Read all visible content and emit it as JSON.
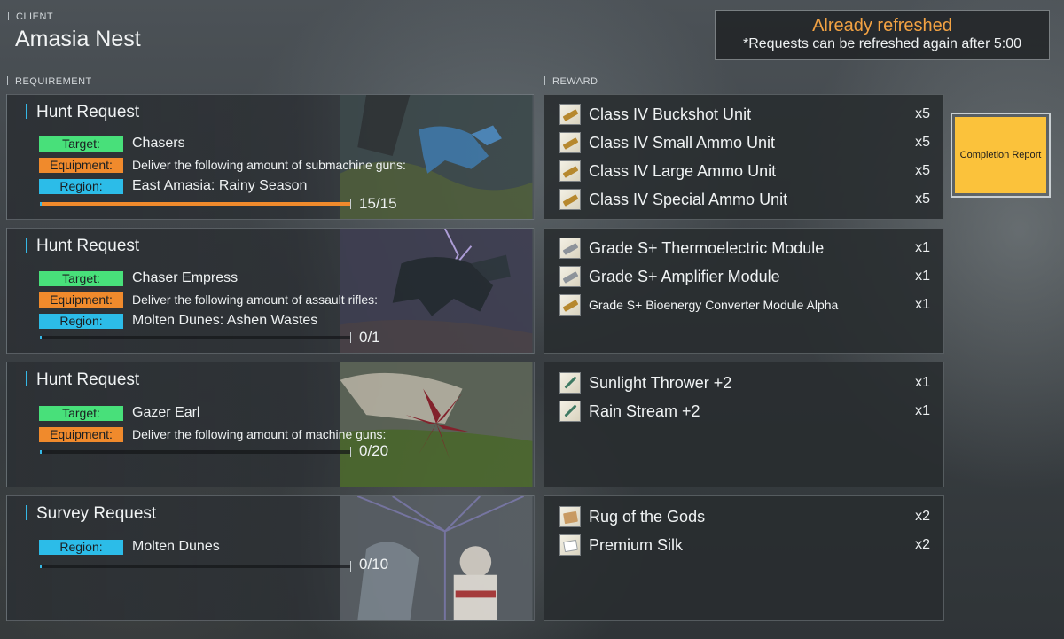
{
  "header": {
    "client_label": "CLIENT",
    "client_name": "Amasia Nest",
    "refresh_title": "Already refreshed",
    "refresh_note": "*Requests can be refreshed again after 5:00"
  },
  "sections": {
    "requirement_label": "REQUIREMENT",
    "reward_label": "REWARD"
  },
  "tags": {
    "target": "Target:",
    "equipment": "Equipment:",
    "region": "Region:"
  },
  "requests": [
    {
      "title": "Hunt Request",
      "target": "Chasers",
      "equipment": "Deliver the following amount of submachine guns:",
      "region": "East Amasia: Rainy Season",
      "progress_text": "15/15",
      "progress_fraction": 1.0,
      "rewards": [
        {
          "name": "Class IV Buckshot Unit",
          "qty": "x5",
          "icon": "ammo-icon"
        },
        {
          "name": "Class IV Small Ammo Unit",
          "qty": "x5",
          "icon": "ammo-icon"
        },
        {
          "name": "Class IV Large Ammo Unit",
          "qty": "x5",
          "icon": "ammo-icon"
        },
        {
          "name": "Class IV Special Ammo Unit",
          "qty": "x5",
          "icon": "ammo-icon"
        }
      ]
    },
    {
      "title": "Hunt Request",
      "target": "Chaser Empress",
      "equipment": "Deliver the following amount of assault rifles:",
      "region": "Molten Dunes: Ashen Wastes",
      "progress_text": "0/1",
      "progress_fraction": 0.0,
      "rewards": [
        {
          "name": "Grade S+ Thermoelectric Module",
          "qty": "x1",
          "icon": "module-icon"
        },
        {
          "name": "Grade S+ Amplifier Module",
          "qty": "x1",
          "icon": "module-icon"
        },
        {
          "name": "Grade S+ Bioenergy Converter Module Alpha",
          "qty": "x1",
          "icon": "module-icon"
        }
      ]
    },
    {
      "title": "Hunt Request",
      "target": "Gazer Earl",
      "equipment": "Deliver the following amount of machine guns:",
      "progress_text": "0/20",
      "progress_fraction": 0.0,
      "rewards": [
        {
          "name": "Sunlight Thrower +2",
          "qty": "x1",
          "icon": "weapon-icon"
        },
        {
          "name": "Rain Stream +2",
          "qty": "x1",
          "icon": "weapon-icon"
        }
      ]
    },
    {
      "title": "Survey Request",
      "region": "Molten Dunes",
      "progress_text": "0/10",
      "progress_fraction": 0.0,
      "rewards": [
        {
          "name": "Rug of the Gods",
          "qty": "x2",
          "icon": "cloth-icon"
        },
        {
          "name": "Premium Silk",
          "qty": "x2",
          "icon": "silk-icon"
        }
      ]
    }
  ],
  "actions": {
    "completion_report": "Completion Report"
  },
  "colors": {
    "target_tag": "#48e07a",
    "equipment_tag": "#f08a2c",
    "region_tag": "#2cbce8",
    "refresh_title": "#f2a243",
    "completion_button": "#fbc23b"
  }
}
